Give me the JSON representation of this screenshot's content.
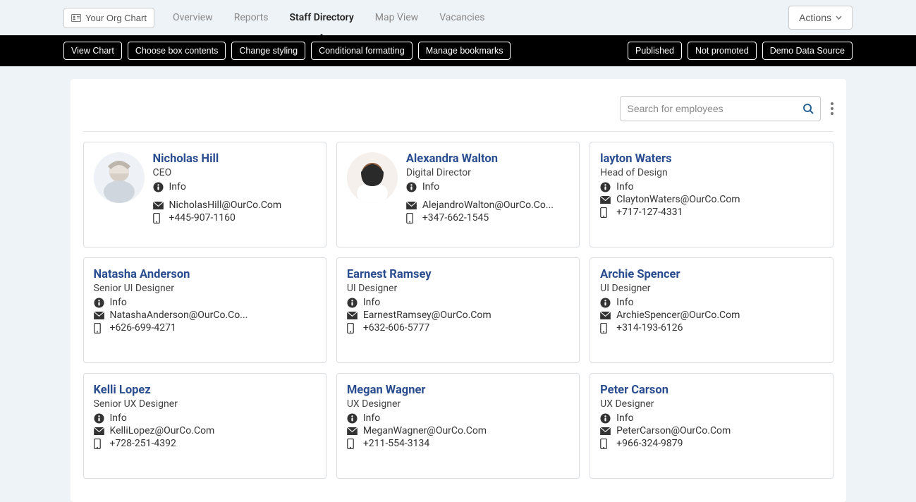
{
  "topnav": {
    "org_chart_label": "Your Org Chart",
    "tabs": {
      "overview": "Overview",
      "reports": "Reports",
      "staff_directory": "Staff Directory",
      "map_view": "Map View",
      "vacancies": "Vacancies"
    },
    "actions_label": "Actions"
  },
  "blackbar": {
    "view_chart": "View Chart",
    "choose_box": "Choose box contents",
    "change_styling": "Change styling",
    "conditional_formatting": "Conditional formatting",
    "manage_bookmarks": "Manage bookmarks",
    "published": "Published",
    "not_promoted": "Not promoted",
    "data_source": "Demo Data Source"
  },
  "search": {
    "placeholder": "Search for employees"
  },
  "info_label": "Info",
  "employees": [
    {
      "name": "Nicholas Hill",
      "role": "CEO",
      "email": "NicholasHill@OurCo.Com",
      "phone": "+445-907-1160",
      "has_avatar": true
    },
    {
      "name": "Alexandra Walton",
      "role": "Digital Director",
      "email": "AlejandroWalton@OurCo.Co...",
      "phone": "+347-662-1545",
      "has_avatar": true
    },
    {
      "name": "layton Waters",
      "role": "Head of Design",
      "email": "ClaytonWaters@OurCo.Com",
      "phone": "+717-127-4331",
      "has_avatar": false
    },
    {
      "name": "Natasha Anderson",
      "role": "Senior UI Designer",
      "email": "NatashaAnderson@OurCo.Co...",
      "phone": "+626-699-4271",
      "has_avatar": false
    },
    {
      "name": "Earnest Ramsey",
      "role": "UI Designer",
      "email": "EarnestRamsey@OurCo.Com",
      "phone": "+632-606-5777",
      "has_avatar": false
    },
    {
      "name": "Archie Spencer",
      "role": "UI Designer",
      "email": "ArchieSpencer@OurCo.Com",
      "phone": "+314-193-6126",
      "has_avatar": false
    },
    {
      "name": "Kelli Lopez",
      "role": "Senior UX Designer",
      "email": "KelliLopez@OurCo.Com",
      "phone": "+728-251-4392",
      "has_avatar": false
    },
    {
      "name": "Megan Wagner",
      "role": "UX Designer",
      "email": "MeganWagner@OurCo.Com",
      "phone": "+211-554-3134",
      "has_avatar": false
    },
    {
      "name": "Peter Carson",
      "role": "UX Designer",
      "email": "PeterCarson@OurCo.Com",
      "phone": "+966-324-9879",
      "has_avatar": false
    }
  ]
}
